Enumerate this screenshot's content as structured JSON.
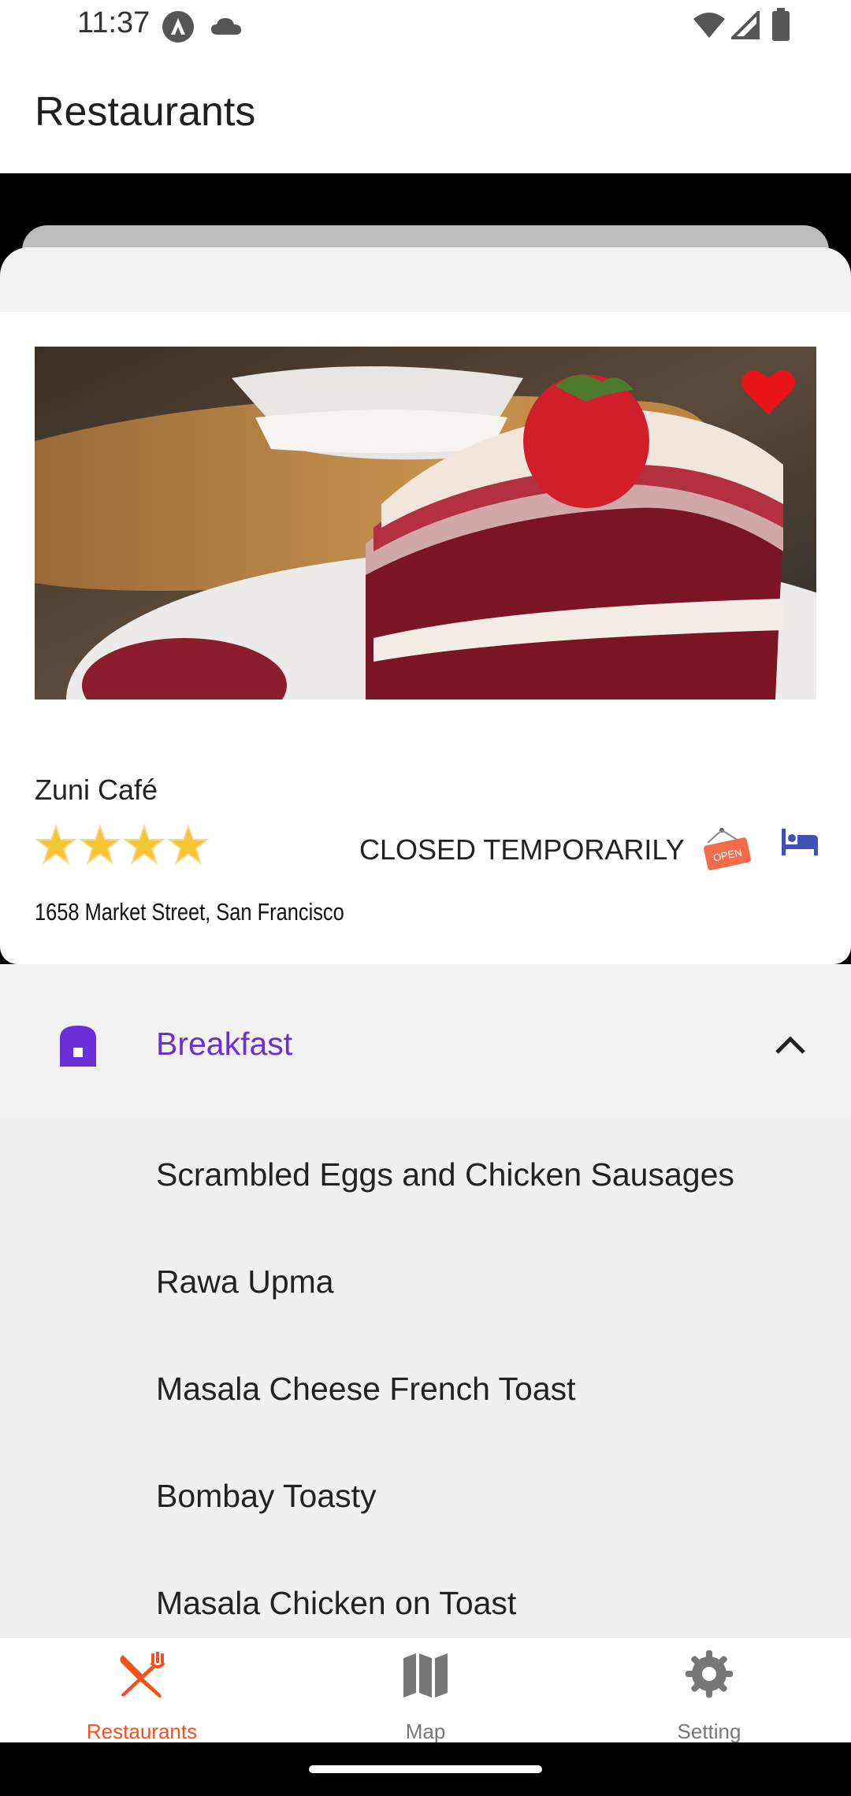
{
  "status_bar": {
    "time": "11:37",
    "icons": [
      "a-icon",
      "cloud-icon",
      "wifi-icon",
      "cell-signal-icon",
      "battery-icon"
    ]
  },
  "app_bar": {
    "title": "Restaurants"
  },
  "restaurant": {
    "name": "Zuni Café",
    "rating": 4,
    "rating_max": 4,
    "status": "CLOSED TEMPORARILY",
    "open_badge": "OPEN",
    "address": "1658 Market Street, San Francisco",
    "favorite": true
  },
  "menu_section": {
    "title": "Breakfast",
    "expanded": true,
    "items": [
      "Scrambled Eggs and Chicken Sausages",
      "Rawa Upma",
      "Masala Cheese French Toast",
      "Bombay Toasty",
      "Masala Chicken on Toast"
    ]
  },
  "bottom_nav": {
    "items": [
      {
        "label": "Restaurants",
        "icon": "fork-knife-icon",
        "active": true
      },
      {
        "label": "Map",
        "icon": "map-icon",
        "active": false
      },
      {
        "label": "Setting",
        "icon": "gear-icon",
        "active": false
      }
    ]
  },
  "colors": {
    "accent_purple": "#6a2fd6",
    "active_nav": "#f4511e",
    "heart": "#e8141a",
    "star": "#f7c531",
    "bed_icon": "#3f51b5"
  }
}
